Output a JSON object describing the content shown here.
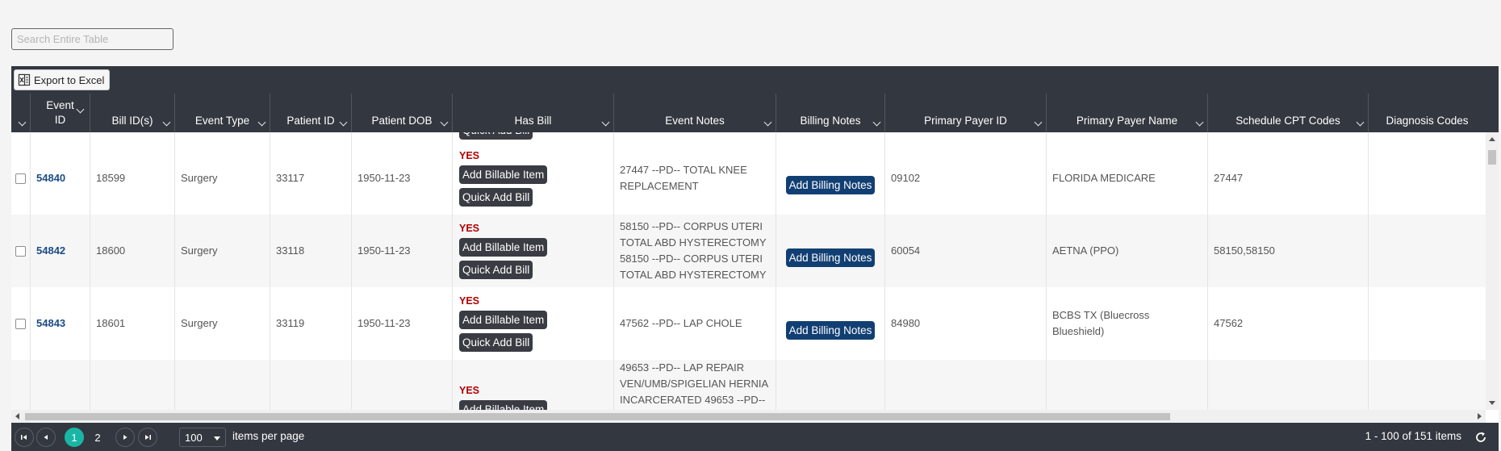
{
  "search": {
    "placeholder": "Search Entire Table"
  },
  "toolbar": {
    "export_label": "Export to Excel"
  },
  "columns": [
    {
      "label": ""
    },
    {
      "label": "Event ID"
    },
    {
      "label": "Bill ID(s)"
    },
    {
      "label": "Event Type"
    },
    {
      "label": "Patient ID"
    },
    {
      "label": "Patient DOB"
    },
    {
      "label": "Has Bill"
    },
    {
      "label": "Event Notes"
    },
    {
      "label": "Billing Notes"
    },
    {
      "label": "Primary Payer ID"
    },
    {
      "label": "Primary Payer Name"
    },
    {
      "label": "Schedule CPT Codes"
    },
    {
      "label": "Diagnosis Codes"
    }
  ],
  "buttons": {
    "yes": "YES",
    "add_billable": "Add Billable Item",
    "quick_add": "Quick Add Bill",
    "add_notes": "Add Billing Notes"
  },
  "rows": [
    {
      "event_id": "54840",
      "bill_id": "18599",
      "event_type": "Surgery",
      "patient_id": "33117",
      "dob": "1950-11-23",
      "notes": "27447 --PD-- TOTAL KNEE REPLACEMENT",
      "payer_id": "09102",
      "payer_name": "FLORIDA MEDICARE",
      "cpt": "27447"
    },
    {
      "event_id": "54842",
      "bill_id": "18600",
      "event_type": "Surgery",
      "patient_id": "33118",
      "dob": "1950-11-23",
      "notes": "58150 --PD-- CORPUS UTERI TOTAL ABD HYSTERECTOMY 58150 --PD-- CORPUS UTERI TOTAL ABD HYSTERECTOMY",
      "payer_id": "60054",
      "payer_name": "AETNA (PPO)",
      "cpt": "58150,58150"
    },
    {
      "event_id": "54843",
      "bill_id": "18601",
      "event_type": "Surgery",
      "patient_id": "33119",
      "dob": "1950-11-23",
      "notes": "47562 --PD-- LAP CHOLE",
      "payer_id": "84980",
      "payer_name": "BCBS TX (Bluecross Blueshield)",
      "cpt": "47562"
    },
    {
      "notes": "49653 --PD-- LAP REPAIR VEN/UMB/SPIGELIAN HERNIA INCARCERATED 49653 --PD--"
    }
  ],
  "pager": {
    "page1": "1",
    "page2": "2",
    "per_page_value": "100",
    "per_page_label": "items per page",
    "info": "1 - 100 of 151 items"
  }
}
